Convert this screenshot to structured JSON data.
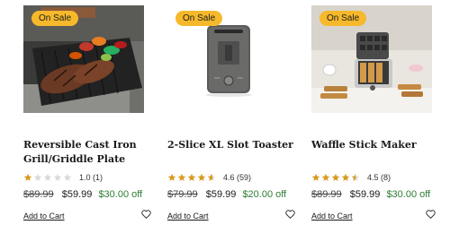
{
  "products": [
    {
      "badge": "On Sale",
      "title": "Reversible Cast Iron Grill/Griddle Plate",
      "rating_text": "1.0 (1)",
      "rating": 1.0,
      "old_price": "$89.99",
      "price": "$59.99",
      "savings": "$30.00 off",
      "add_label": "Add to Cart",
      "icon": "heart-icon"
    },
    {
      "badge": "On Sale",
      "title": "2-Slice XL Slot Toaster",
      "rating_text": "4.6 (59)",
      "rating": 4.6,
      "old_price": "$79.99",
      "price": "$59.99",
      "savings": "$20.00 off",
      "add_label": "Add to Cart",
      "icon": "heart-icon"
    },
    {
      "badge": "On Sale",
      "title": "Waffle Stick Maker",
      "rating_text": "4.5 (8)",
      "rating": 4.5,
      "old_price": "$89.99",
      "price": "$59.99",
      "savings": "$30.00 off",
      "add_label": "Add to Cart",
      "icon": "heart-icon"
    }
  ],
  "colors": {
    "badge": "#f6b92b",
    "star_filled": "#d99a1c",
    "star_empty": "#d9d9d9",
    "savings": "#2e7d32"
  }
}
